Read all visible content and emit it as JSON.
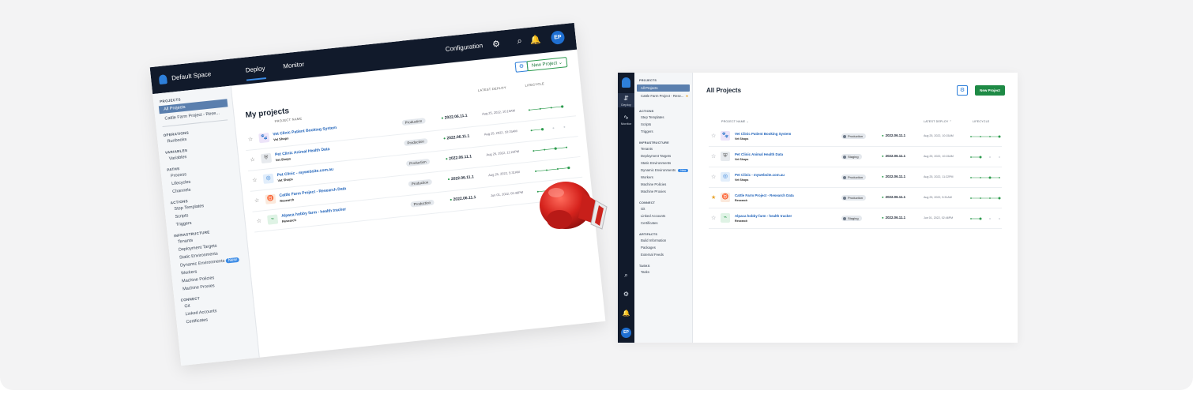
{
  "old_ui": {
    "top_bar": {
      "space_name": "Default Space",
      "tabs": [
        "Deploy",
        "Monitor"
      ],
      "configuration_label": "Configuration",
      "avatar_initials": "EP"
    },
    "sidebar": {
      "projects_heading": "PROJECTS",
      "projects": [
        "All Projects",
        "Cattle Farm Project - Rese..."
      ],
      "operations_heading": "OPERATIONS",
      "operations": [
        "Runbooks"
      ],
      "variables_heading": "VARIABLES",
      "variables": [
        "Variables"
      ],
      "paths_heading": "PATHS",
      "paths": [
        "Process",
        "Lifecycles",
        "Channels"
      ],
      "actions_heading": "ACTIONS",
      "actions": [
        "Step Templates",
        "Scripts",
        "Triggers"
      ],
      "infrastructure_heading": "INFRASTRUCTURE",
      "infrastructure": [
        "Tenants",
        "Deployment Targets",
        "Static Environments",
        "Dynamic Environments",
        "Workers",
        "Machine Policies",
        "Machine Proxies"
      ],
      "new_badge": "New",
      "connect_heading": "CONNECT",
      "connect": [
        "Git",
        "Linked Accounts",
        "Certificates"
      ]
    },
    "main": {
      "title": "My projects",
      "new_project_label": "New Project",
      "columns": {
        "project_name": "PROJECT NAME",
        "latest_deploy": "LATEST DEPLOY",
        "lifecycle": "LIFECYCLE"
      },
      "rows": [
        {
          "name": "Vet Clinic Patient Booking System",
          "group": "Vet Shops",
          "env": "Production",
          "version": "2022.06.11.1",
          "date": "Aug 25, 2022, 10:15AM",
          "favorite": false
        },
        {
          "name": "Pet Clinic Animal Health Data",
          "group": "Vet Shops",
          "env": "Production",
          "version": "2022.06.11.1",
          "date": "Aug 25, 2022, 10:15AM",
          "favorite": false
        },
        {
          "name": "Pet Clinic - mywebsite.com.au",
          "group": "Vet Shops",
          "env": "Production",
          "version": "2022.06.11.1",
          "date": "Aug 25, 2022, 11:22PM",
          "favorite": false
        },
        {
          "name": "Cattle Farm Project - Research Data",
          "group": "Research",
          "env": "Production",
          "version": "2022.06.11.1",
          "date": "Aug 25, 2022, 5:31AM",
          "favorite": false
        },
        {
          "name": "Alpaca hobby farm - health tracker",
          "group": "Research",
          "env": "Production",
          "version": "2022.06.11.1",
          "date": "Jun 01, 2022, 02:46PM",
          "favorite": false
        }
      ]
    }
  },
  "new_ui": {
    "rail": {
      "deploy_label": "Deploy",
      "monitor_label": "Monitor",
      "avatar_initials": "EP"
    },
    "sidebar": {
      "projects_heading": "PROJECTS",
      "projects": [
        "All Projects",
        "Cattle Farm Project - Rese..."
      ],
      "actions_heading": "ACTIONS",
      "actions": [
        "Step Templates",
        "Scripts",
        "Triggers"
      ],
      "infrastructure_heading": "INFRASTRUCTURE",
      "infrastructure": [
        "Tenants",
        "Deployment Targets",
        "Static Environments",
        "Dynamic Environments",
        "Workers",
        "Machine Policies",
        "Machine Proxies"
      ],
      "new_badge": "New",
      "connect_heading": "CONNECT",
      "connect": [
        "Git",
        "Linked Accounts",
        "Certificates"
      ],
      "artifacts_heading": "ARTIFACTS",
      "artifacts": [
        "Build Information",
        "Packages",
        "External Feeds"
      ],
      "tasks_heading": "TASKS",
      "tasks": [
        "Tasks"
      ]
    },
    "main": {
      "title": "All Projects",
      "new_project_label": "New Project",
      "columns": {
        "project_name": "PROJECT NAME",
        "latest_deploy": "LATEST DEPLOY",
        "lifecycle": "LIFECYCLE"
      },
      "rows": [
        {
          "name": "Vet Clinic Patient Booking System",
          "group": "Vet Shops",
          "env": "Production",
          "version": "2022.06.11.1",
          "date": "Aug 25, 2022, 10:15AM",
          "favorite": false
        },
        {
          "name": "Pet Clinic Animal Health Data",
          "group": "Vet Shops",
          "env": "Staging",
          "version": "2022.06.11.1",
          "date": "Aug 25, 2022, 10:15AM",
          "favorite": false
        },
        {
          "name": "Pet Clinic - mywebsite.com.au",
          "group": "Vet Shops",
          "env": "Production",
          "version": "2022.06.11.1",
          "date": "Aug 25, 2022, 11:22PM",
          "favorite": false
        },
        {
          "name": "Cattle Farm Project - Research Data",
          "group": "Research",
          "env": "Production",
          "version": "2022.06.11.1",
          "date": "Aug 25, 2022, 5:31AM",
          "favorite": true
        },
        {
          "name": "Alpaca hobby farm - health tracker",
          "group": "Research",
          "env": "Staging",
          "version": "2022.06.11.1",
          "date": "Jun 01, 2022, 02:46PM",
          "favorite": false
        }
      ]
    }
  },
  "colors": {
    "accent": "#2e7fd9",
    "new_project_green": "#1e8a45",
    "success": "#2c9b4d",
    "favorite": "#e8a42d",
    "nav_dark": "#111a2b"
  },
  "icons": [
    "paw-icon",
    "vet-icon",
    "globe-icon",
    "cow-icon",
    "pulse-icon",
    "boxing-glove-icon",
    "gear-icon",
    "search-icon",
    "bell-icon",
    "star-icon",
    "check-circle-icon"
  ]
}
